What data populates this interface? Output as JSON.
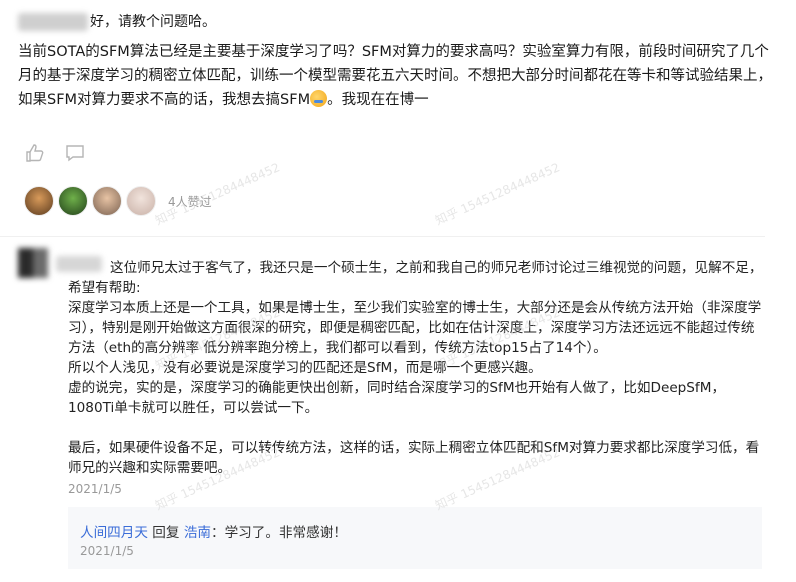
{
  "question": {
    "greeting": "好，请教个问题哈。",
    "body_before_emoji": "当前SOTA的SFM算法已经是主要基于深度学习了吗？SFM对算力的要求高吗？实验室算力有限，前段时间研究了几个月的基于深度学习的稠密立体匹配，训练一个模型需要花五六天时间。不想把大部分时间都花在等卡和等试验结果上，如果SFM对算力要求不高的话，我想去搞SFM",
    "body_after_emoji": "。我现在在博一",
    "likes_text": "4人赞过"
  },
  "reply": {
    "body_lines": [
      "这位师兄太过于客气了，我还只是一个硕士生，之前和我自己的师兄老师讨论过三维视觉的问题，见解不足，希望有帮助:",
      "深度学习本质上还是一个工具，如果是博士生，至少我们实验室的博士生，大部分还是会从传统方法开始（非深度学习），特别是刚开始做这方面很深的研究，即便是稠密匹配，比如在估计深度上，深度学习方法还远远不能超过传统方法（eth的高分辨率 低分辨率跑分榜上，我们都可以看到，传统方法top15占了14个）。",
      "所以个人浅见，没有必要说是深度学习的匹配还是SfM，而是哪一个更感兴趣。",
      "虚的说完，实的是，深度学习的确能更快出创新，同时结合深度学习的SfM也开始有人做了，比如DeepSfM，1080Ti单卡就可以胜任，可以尝试一下。"
    ],
    "closing": "最后，如果硬件设备不足，可以转传统方法，这样的话，实际上稠密立体匹配和SfM对算力要求都比深度学习低，看师兄的兴趣和实际需要吧。",
    "date": "2021/1/5"
  },
  "sub_reply": {
    "user": "人间四月天",
    "action": "回复",
    "target": "浩南",
    "text": "：学习了。非常感谢！",
    "date": "2021/1/5"
  },
  "watermark_text": "知乎 15451284448452",
  "icons": [
    "like-icon",
    "comment-icon"
  ]
}
